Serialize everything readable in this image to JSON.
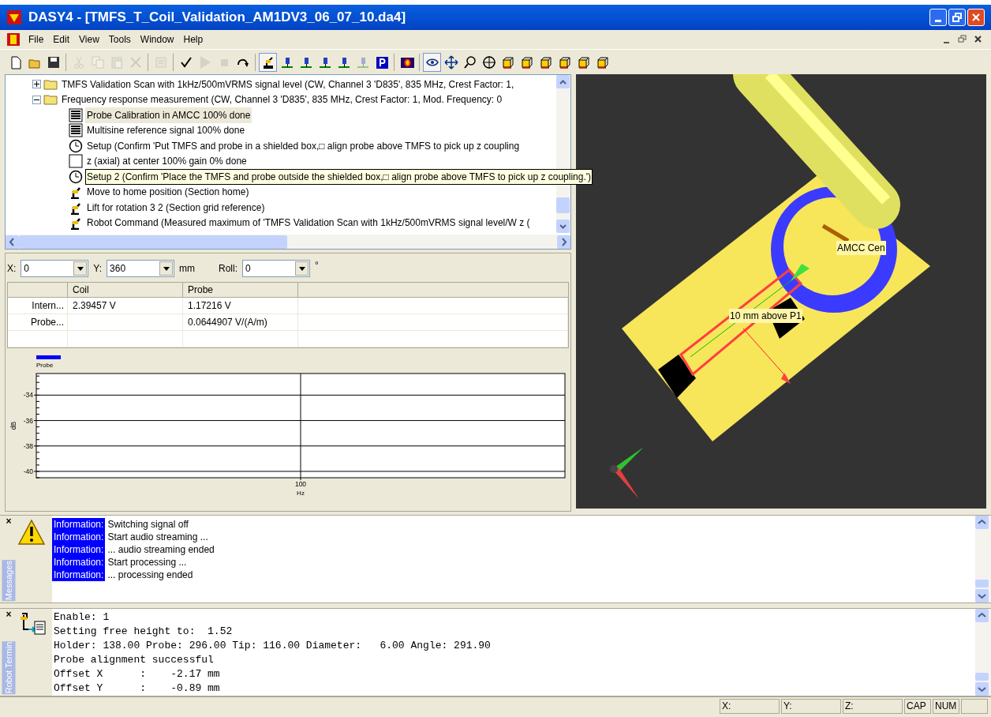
{
  "window": {
    "title": "DASY4 - [TMFS_T_Coil_Validation_AM1DV3_06_07_10.da4]"
  },
  "menu": [
    "File",
    "Edit",
    "View",
    "Tools",
    "Window",
    "Help"
  ],
  "toolbar": [
    {
      "kind": "new",
      "disabled": false,
      "selected": false
    },
    {
      "kind": "open",
      "disabled": false,
      "selected": false
    },
    {
      "kind": "save",
      "disabled": false,
      "selected": false
    },
    {
      "kind": "separator"
    },
    {
      "kind": "cut",
      "disabled": true,
      "selected": false
    },
    {
      "kind": "copy",
      "disabled": true,
      "selected": false
    },
    {
      "kind": "paste",
      "disabled": true,
      "selected": false
    },
    {
      "kind": "delete",
      "disabled": true,
      "selected": false
    },
    {
      "kind": "separator"
    },
    {
      "kind": "properties",
      "disabled": true,
      "selected": false
    },
    {
      "kind": "separator"
    },
    {
      "kind": "check",
      "disabled": false,
      "selected": false
    },
    {
      "kind": "play",
      "disabled": true,
      "selected": false
    },
    {
      "kind": "stop",
      "disabled": true,
      "selected": false
    },
    {
      "kind": "undo",
      "disabled": false,
      "selected": false
    },
    {
      "kind": "separator"
    },
    {
      "kind": "robot",
      "disabled": false,
      "selected": true
    },
    {
      "kind": "probe",
      "disabled": false,
      "selected": false
    },
    {
      "kind": "probe",
      "disabled": false,
      "selected": false
    },
    {
      "kind": "probe",
      "disabled": false,
      "selected": false
    },
    {
      "kind": "probe",
      "disabled": false,
      "selected": false
    },
    {
      "kind": "probe",
      "disabled": true,
      "selected": false
    },
    {
      "kind": "pbox",
      "disabled": false,
      "selected": false
    },
    {
      "kind": "separator"
    },
    {
      "kind": "signal",
      "disabled": false,
      "selected": false
    },
    {
      "kind": "separator"
    },
    {
      "kind": "eye",
      "disabled": false,
      "selected": true
    },
    {
      "kind": "move",
      "disabled": false,
      "selected": false
    },
    {
      "kind": "zoom",
      "disabled": false,
      "selected": false
    },
    {
      "kind": "target",
      "disabled": false,
      "selected": false
    },
    {
      "kind": "cube",
      "disabled": false,
      "selected": false
    },
    {
      "kind": "cube",
      "disabled": false,
      "selected": false
    },
    {
      "kind": "cube",
      "disabled": false,
      "selected": false
    },
    {
      "kind": "cube",
      "disabled": false,
      "selected": false
    },
    {
      "kind": "cube",
      "disabled": false,
      "selected": false
    },
    {
      "kind": "cube",
      "disabled": false,
      "selected": false
    }
  ],
  "tree": [
    {
      "kind": "folder",
      "label": "TMFS Validation Scan with 1kHz/500mVRMS signal level (CW, Channel 3 'D835', 835 MHz, Crest Factor: 1,",
      "expanded": false,
      "selected": false,
      "hovered": false
    },
    {
      "kind": "folder",
      "label": "Frequency response measurement (CW, Channel 3 'D835', 835 MHz, Crest Factor: 1, Mod. Frequency: 0",
      "expanded": true,
      "selected": false,
      "hovered": false,
      "children": [
        {
          "kind": "list",
          "label": "Probe Calibration in AMCC 100% done",
          "selected": true,
          "hovered": false
        },
        {
          "kind": "list",
          "label": "Multisine  reference signal 100% done",
          "selected": false,
          "hovered": false
        },
        {
          "kind": "clock",
          "label": "Setup (Confirm 'Put TMFS and probe in a shielded box,□ align probe above TMFS to pick up z coupling",
          "selected": false,
          "hovered": false
        },
        {
          "kind": "blank",
          "label": "z (axial) at center 100% gain 0% done",
          "selected": false,
          "hovered": false
        },
        {
          "kind": "clock",
          "label": "Setup 2 (Confirm 'Place the TMFS and probe outside the shielded box,□ align probe above TMFS to pick up z coupling.')",
          "selected": false,
          "hovered": true
        },
        {
          "kind": "robot",
          "label": "Move to home position (Section home)",
          "selected": false,
          "hovered": false
        },
        {
          "kind": "robot",
          "label": "Lift for rotation 3 2 (Section grid reference)",
          "selected": false,
          "hovered": false
        },
        {
          "kind": "robot",
          "label": "Robot Command (Measured maximum of 'TMFS Validation Scan with 1kHz/500mVRMS signal level/W z (",
          "selected": false,
          "hovered": false
        }
      ]
    }
  ],
  "position": {
    "x": {
      "label": "X:",
      "value": "0"
    },
    "y": {
      "label": "Y:",
      "value": "360"
    },
    "unit": "mm",
    "roll": {
      "label": "Roll:",
      "value": "0"
    },
    "roll_unit": "°"
  },
  "table": {
    "columns": [
      "Coil",
      "Probe"
    ],
    "rows": [
      {
        "header": "Intern...",
        "coil": "2.39457 V",
        "probe": "1.17216 V"
      },
      {
        "header": "Probe...",
        "probe": "0.0644907 V/(A/m)"
      }
    ]
  },
  "chart_data": {
    "type": "line",
    "grid": true,
    "xlabel": "Hz",
    "ylabel": "dB",
    "categories": [
      "100"
    ],
    "series": [
      {
        "name": "Probe",
        "color": "#0000ff",
        "values": [
          null
        ]
      }
    ],
    "ylim": [
      -40.5,
      -32.3
    ],
    "yticks": [
      -40,
      -38,
      -36,
      -34
    ]
  },
  "scene": {
    "labels": [
      "10 mm above P1",
      "AMCC Cen"
    ]
  },
  "messages": {
    "tab": "Messages",
    "items": [
      {
        "level": "Information:",
        "text": "Switching signal off"
      },
      {
        "level": "Information:",
        "text": "Start audio streaming ..."
      },
      {
        "level": "Information:",
        "text": "... audio streaming ended"
      },
      {
        "level": "Information:",
        "text": "Start processing ..."
      },
      {
        "level": "Information:",
        "text": "... processing ended"
      }
    ]
  },
  "terminal": {
    "tab": "Robot Termin",
    "lines": [
      "Enable: 1",
      "Setting free height to:  1.52",
      "Holder: 138.00 Probe: 296.00 Tip: 116.00 Diameter:   6.00 Angle: 291.90",
      "Probe alignment successful",
      "Offset X      :    -2.17 mm",
      "Offset Y      :    -0.89 mm"
    ]
  },
  "close_mark": "×",
  "status_bar": [
    "X:",
    "Y:",
    "Z:",
    "CAP",
    "NUM"
  ]
}
